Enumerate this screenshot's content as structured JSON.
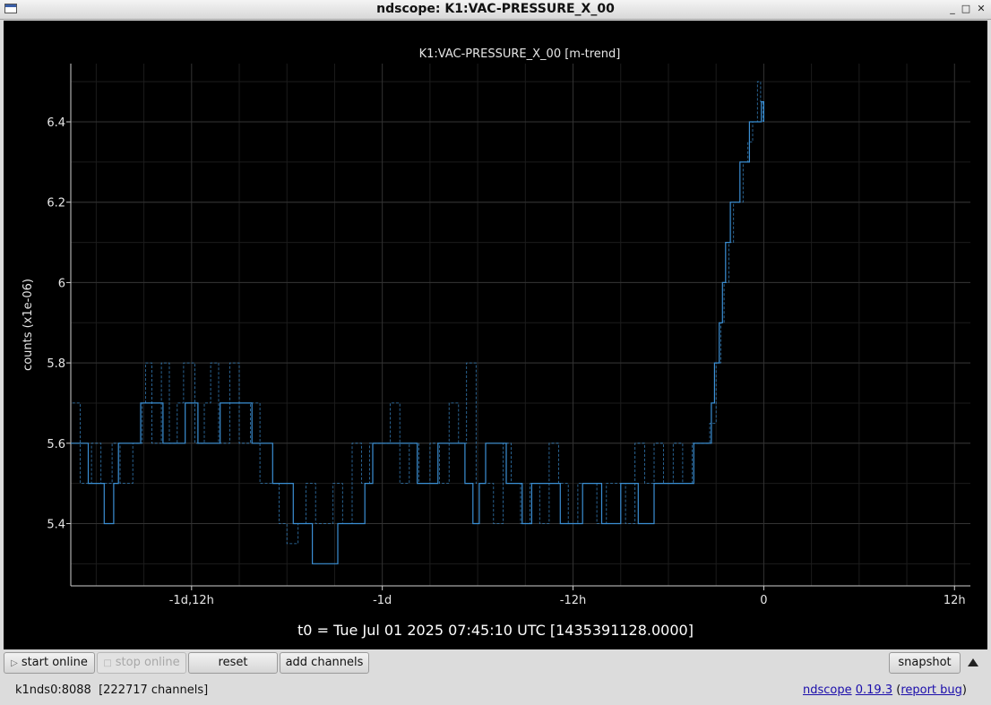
{
  "window": {
    "title": "ndscope: K1:VAC-PRESSURE_X_00",
    "minimize_glyph": "_",
    "maximize_glyph": "□",
    "close_glyph": "✕"
  },
  "toolbar": {
    "start_online": "start online",
    "stop_online": "stop online",
    "reset": "reset",
    "add_channels": "add channels",
    "snapshot": "snapshot"
  },
  "status": {
    "server": "k1nds0:8088",
    "channels": "[222717 channels]",
    "app_name": "ndscope",
    "version": "0.19.3",
    "paren_open": "(",
    "report_bug": "report bug",
    "paren_close": ")"
  },
  "t0": "t0 = Tue Jul 01 2025 07:45:10 UTC [1435391128.0000]",
  "colors": {
    "trace": "#3b8fd4",
    "background": "#000000",
    "grid": "#333333",
    "axis": "#cfcfcf"
  },
  "chart_data": {
    "type": "line",
    "title": "K1:VAC-PRESSURE_X_00 [m-trend]",
    "ylabel": "counts (x1e-06)",
    "xlabel": "",
    "x_unit": "hours relative to t0",
    "xlim": [
      -43.6,
      13.0
    ],
    "ylim": [
      5.245,
      6.545
    ],
    "grid": true,
    "x_ticks": [
      {
        "value": -36,
        "label": "-1d,12h"
      },
      {
        "value": -24,
        "label": "-1d"
      },
      {
        "value": -12,
        "label": "-12h"
      },
      {
        "value": 0,
        "label": "0"
      },
      {
        "value": 12,
        "label": "12h"
      }
    ],
    "y_ticks": [
      {
        "value": 5.4,
        "label": "5.4"
      },
      {
        "value": 5.6,
        "label": "5.6"
      },
      {
        "value": 5.8,
        "label": "5.8"
      },
      {
        "value": 6.0,
        "label": "6"
      },
      {
        "value": 6.2,
        "label": "6.2"
      },
      {
        "value": 6.4,
        "label": "6.4"
      }
    ],
    "series": [
      {
        "style": "solid",
        "x": [
          -43.6,
          -42.9,
          -42.5,
          -41.6,
          -41.5,
          -40.9,
          -40.6,
          -39.6,
          -39.2,
          -38.2,
          -37.8,
          -36.7,
          -36.4,
          -35.9,
          -35.6,
          -34.7,
          -34.2,
          -33.2,
          -32.2,
          -31.2,
          -30.9,
          -30.2,
          -29.6,
          -28.6,
          -28.4,
          -27.4,
          -26.8,
          -25.9,
          -25.6,
          -25.1,
          -24.6,
          -23.6,
          -22.8,
          -21.8,
          -21.5,
          -20.5,
          -19.9,
          -18.8,
          -18.3,
          -17.9,
          -17.5,
          -16.6,
          -16.2,
          -15.6,
          -15.2,
          -14.6,
          -14.2,
          -13.2,
          -12.8,
          -11.9,
          -11.4,
          -10.6,
          -10.2,
          -9.6,
          -9.0,
          -8.4,
          -7.9,
          -7.3,
          -6.9,
          -6.2,
          -5.8,
          -4.9,
          -4.4,
          -3.6,
          -3.3,
          -3.1,
          -2.8,
          -2.6,
          -2.4,
          -2.1,
          -1.8,
          -1.5,
          -1.2,
          -0.9,
          -0.6,
          -0.3,
          -0.15,
          0.0
        ],
        "y": [
          5.6,
          5.6,
          5.5,
          5.5,
          5.4,
          5.5,
          5.6,
          5.6,
          5.7,
          5.7,
          5.6,
          5.6,
          5.7,
          5.7,
          5.6,
          5.6,
          5.7,
          5.7,
          5.6,
          5.6,
          5.5,
          5.5,
          5.4,
          5.4,
          5.3,
          5.3,
          5.4,
          5.4,
          5.4,
          5.5,
          5.6,
          5.6,
          5.6,
          5.5,
          5.5,
          5.6,
          5.6,
          5.5,
          5.4,
          5.5,
          5.6,
          5.6,
          5.5,
          5.5,
          5.4,
          5.5,
          5.5,
          5.5,
          5.4,
          5.4,
          5.5,
          5.5,
          5.4,
          5.4,
          5.5,
          5.5,
          5.4,
          5.4,
          5.5,
          5.5,
          5.5,
          5.5,
          5.6,
          5.6,
          5.7,
          5.8,
          5.9,
          6.0,
          6.1,
          6.2,
          6.2,
          6.3,
          6.3,
          6.4,
          6.4,
          6.4,
          6.45,
          6.4
        ]
      },
      {
        "style": "dashed",
        "x": [
          -43.5,
          -43.0,
          -42.3,
          -41.7,
          -41.0,
          -40.5,
          -39.7,
          -39.1,
          -38.9,
          -38.5,
          -37.9,
          -37.4,
          -36.9,
          -36.5,
          -35.8,
          -35.2,
          -34.8,
          -34.3,
          -33.6,
          -33.0,
          -32.3,
          -31.7,
          -31.1,
          -30.5,
          -30.0,
          -29.3,
          -28.8,
          -28.2,
          -27.7,
          -27.1,
          -26.5,
          -25.9,
          -25.3,
          -24.8,
          -24.2,
          -23.5,
          -22.9,
          -22.3,
          -21.7,
          -21.0,
          -20.4,
          -19.8,
          -19.2,
          -18.7,
          -18.1,
          -17.6,
          -17.0,
          -16.4,
          -15.9,
          -15.3,
          -14.7,
          -14.1,
          -13.5,
          -12.9,
          -12.3,
          -11.7,
          -11.1,
          -10.5,
          -9.9,
          -9.3,
          -8.7,
          -8.1,
          -7.5,
          -6.9,
          -6.3,
          -5.7,
          -5.1,
          -4.5,
          -3.9,
          -3.4,
          -3.0,
          -2.7,
          -2.5,
          -2.2,
          -1.9,
          -1.6,
          -1.3,
          -1.0,
          -0.7,
          -0.4,
          -0.2,
          -0.05
        ],
        "y": [
          5.7,
          5.5,
          5.6,
          5.5,
          5.6,
          5.5,
          5.6,
          5.7,
          5.8,
          5.6,
          5.8,
          5.6,
          5.7,
          5.8,
          5.6,
          5.7,
          5.8,
          5.6,
          5.8,
          5.6,
          5.7,
          5.5,
          5.5,
          5.4,
          5.35,
          5.4,
          5.5,
          5.4,
          5.4,
          5.5,
          5.4,
          5.6,
          5.5,
          5.6,
          5.6,
          5.7,
          5.5,
          5.6,
          5.5,
          5.6,
          5.5,
          5.7,
          5.6,
          5.8,
          5.5,
          5.5,
          5.4,
          5.6,
          5.5,
          5.4,
          5.5,
          5.4,
          5.6,
          5.5,
          5.4,
          5.5,
          5.5,
          5.4,
          5.5,
          5.5,
          5.4,
          5.6,
          5.5,
          5.6,
          5.5,
          5.6,
          5.5,
          5.6,
          5.6,
          5.65,
          5.8,
          5.9,
          6.0,
          6.1,
          6.2,
          6.2,
          6.3,
          6.35,
          6.4,
          6.5,
          6.45,
          6.4
        ]
      }
    ]
  }
}
